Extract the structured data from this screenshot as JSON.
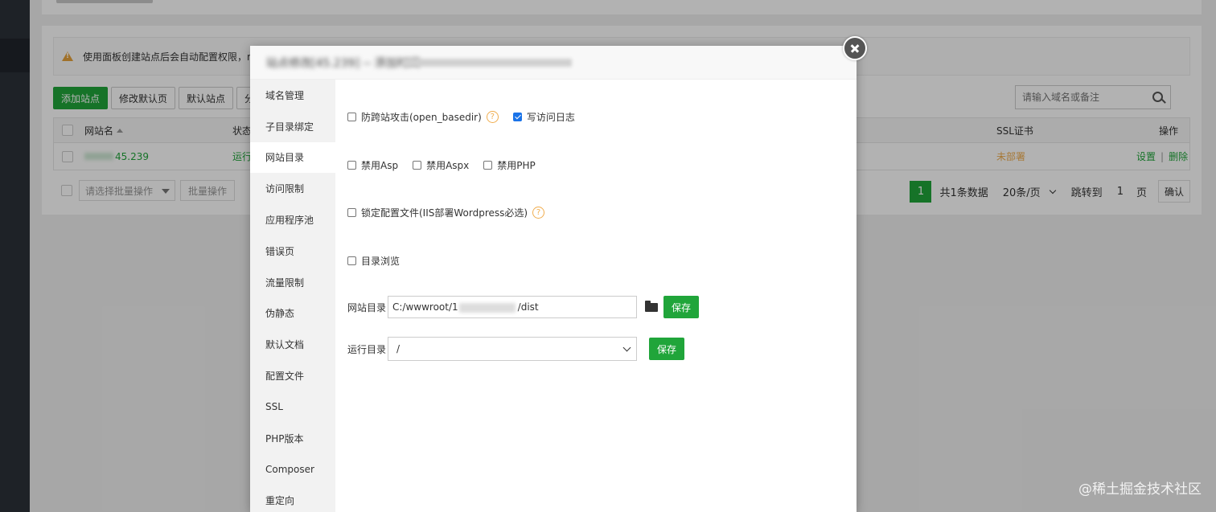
{
  "page": {
    "warning_text": "使用面板创建站点后会自动配置权限，ng",
    "toolbar": [
      "添加站点",
      "修改默认页",
      "默认站点",
      "分"
    ],
    "search_placeholder": "请输入域名或备注",
    "table": {
      "headers": {
        "name": "网站名",
        "status": "状态",
        "ssl": "SSL证书",
        "ops": "操作"
      },
      "row": {
        "name": "45.239",
        "status": "运行",
        "ssl": "未部署",
        "op_settings": "设置",
        "op_sep": "|",
        "op_delete": "删除"
      }
    },
    "bulk": {
      "select_placeholder": "请选择批量操作",
      "button": "批量操作"
    },
    "pager": {
      "current": "1",
      "total": "共1条数据",
      "per_page": "20条/页",
      "jump_label": "跳转到",
      "jump_value": "1",
      "page_unit": "页",
      "confirm": "确认"
    }
  },
  "modal": {
    "title": "站点修改[45.239] -- 添加时间",
    "nav": [
      "域名管理",
      "子目录绑定",
      "网站目录",
      "访问限制",
      "应用程序池",
      "错误页",
      "流量限制",
      "伪静态",
      "默认文档",
      "配置文件",
      "SSL",
      "PHP版本",
      "Composer",
      "重定向"
    ],
    "active_nav": 2,
    "options": {
      "anti_cross": {
        "label": "防跨站攻击(open_basedir)",
        "checked": false
      },
      "write_log": {
        "label": "写访问日志",
        "checked": true
      },
      "no_asp": {
        "label": "禁用Asp",
        "checked": false
      },
      "no_aspx": {
        "label": "禁用Aspx",
        "checked": false
      },
      "no_php": {
        "label": "禁用PHP",
        "checked": false
      },
      "lock_config": {
        "label": "锁定配置文件(IIS部署Wordpress必选)",
        "checked": false
      },
      "dir_browse": {
        "label": "目录浏览",
        "checked": false
      }
    },
    "site_dir": {
      "label": "网站目录",
      "value_prefix": "C:/wwwroot/1",
      "value_suffix": "/dist",
      "save": "保存"
    },
    "run_dir": {
      "label": "运行目录",
      "value": "/",
      "save": "保存"
    },
    "help_glyph": "?"
  },
  "watermark": "@稀土掘金技术社区"
}
